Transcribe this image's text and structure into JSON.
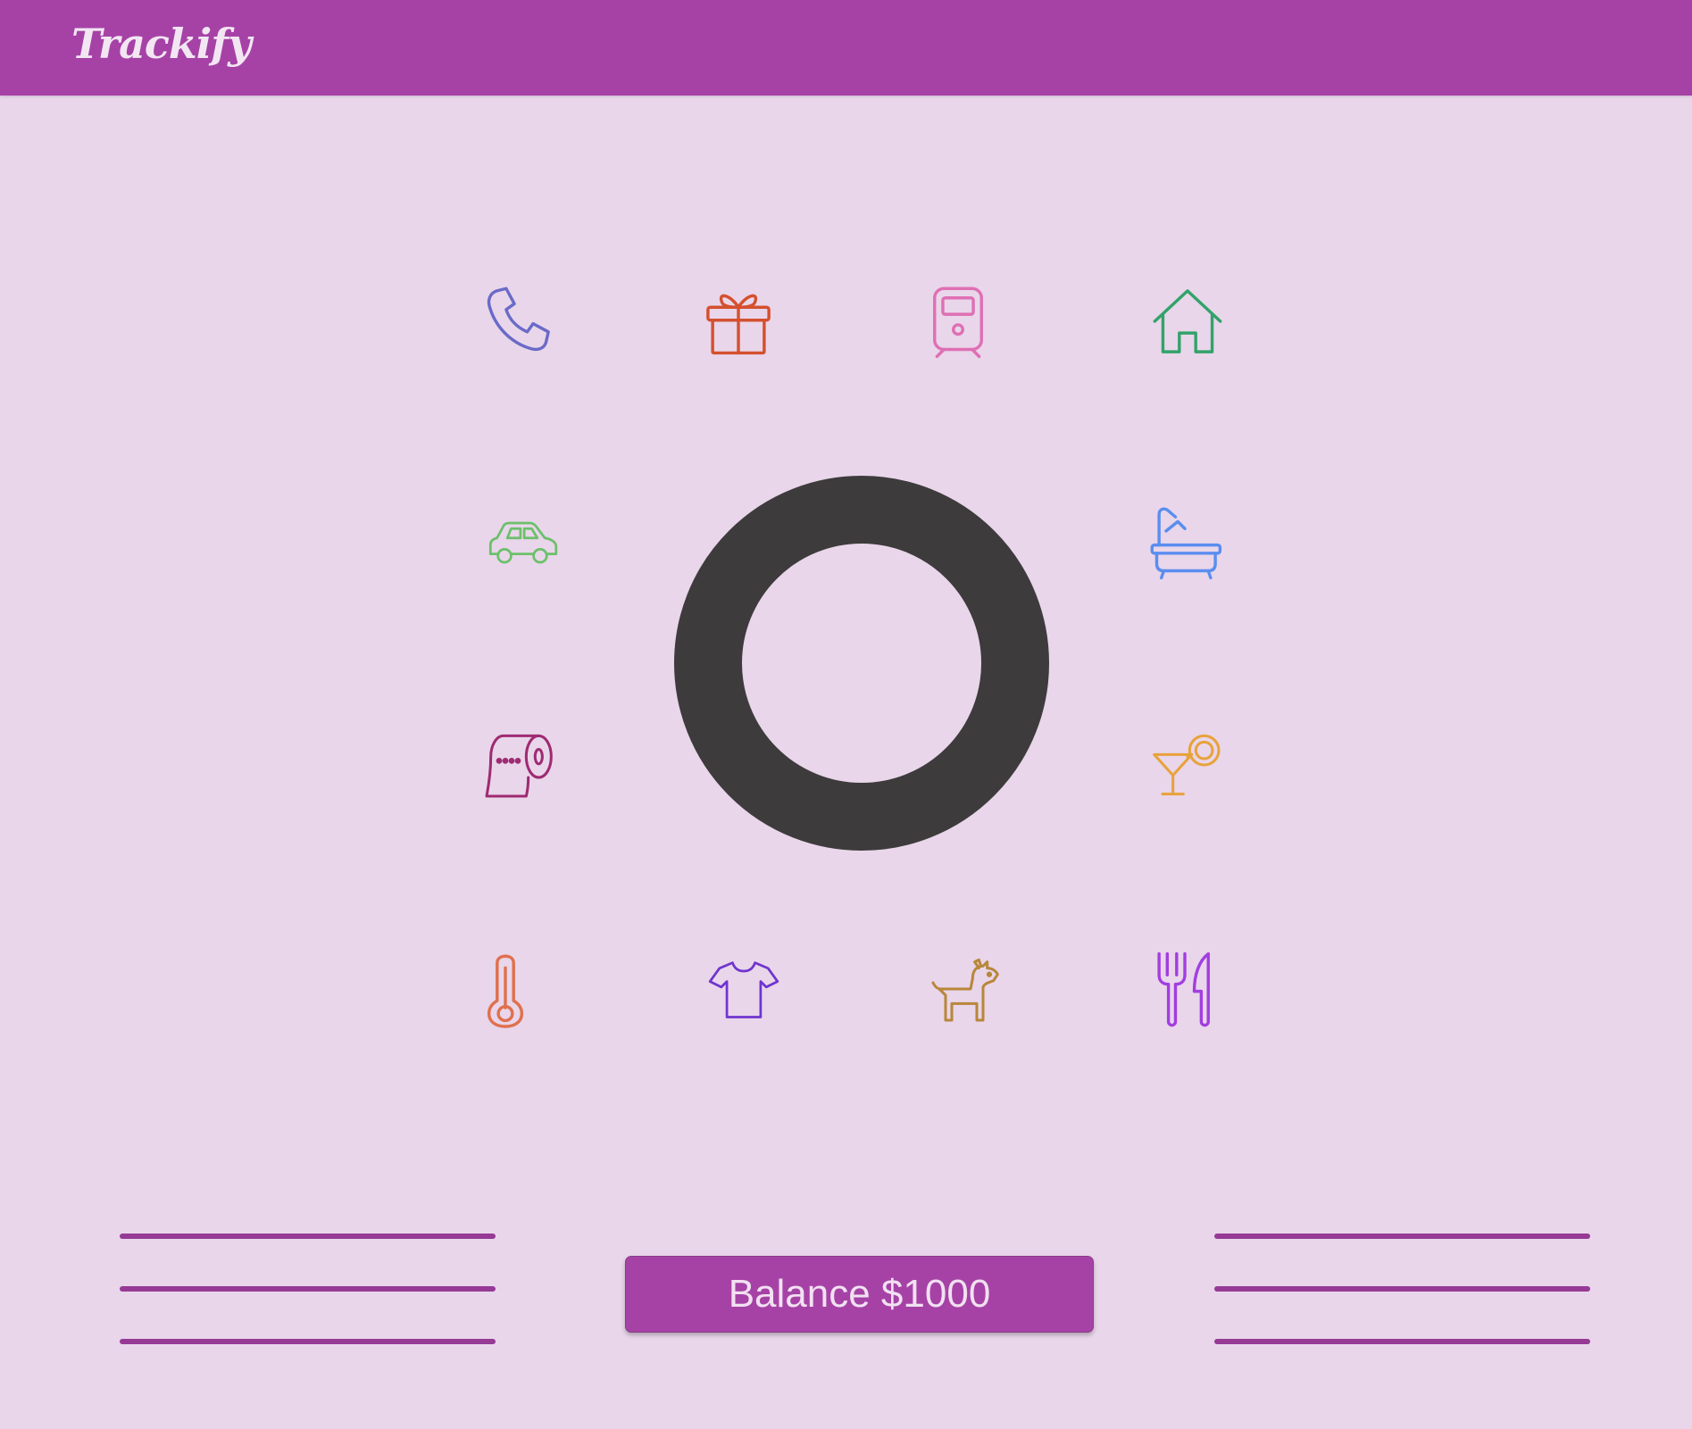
{
  "app": {
    "brand": "Trackify"
  },
  "colors": {
    "header": "#a642a6",
    "background": "#e9d6ea",
    "donut": "#3d3b3c",
    "lines": "#963a96"
  },
  "categories": [
    {
      "icon": "phone-icon",
      "color": "#6a6ac8"
    },
    {
      "icon": "gift-icon",
      "color": "#d4502e"
    },
    {
      "icon": "train-icon",
      "color": "#df6fb4"
    },
    {
      "icon": "home-icon",
      "color": "#32a36a"
    },
    {
      "icon": "car-icon",
      "color": "#6cc06a"
    },
    {
      "icon": "bathtub-icon",
      "color": "#5a8ef0"
    },
    {
      "icon": "toilet-paper-icon",
      "color": "#9e2b72"
    },
    {
      "icon": "cocktail-icon",
      "color": "#e8a23a"
    },
    {
      "icon": "thermometer-icon",
      "color": "#e0704e"
    },
    {
      "icon": "tshirt-icon",
      "color": "#6f35cf"
    },
    {
      "icon": "dog-icon",
      "color": "#b8873a"
    },
    {
      "icon": "utensils-icon",
      "color": "#a23ee0"
    }
  ],
  "balance": {
    "label": "Balance $1000"
  }
}
